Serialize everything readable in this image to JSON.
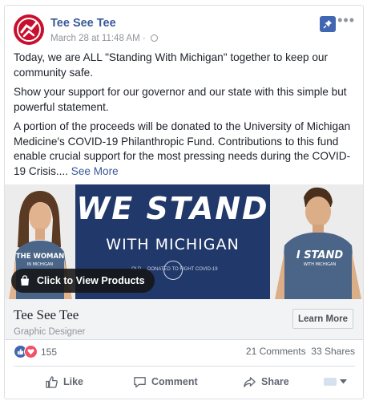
{
  "post": {
    "page_name": "Tee See Tee",
    "timestamp": "March 28 at 11:48 AM",
    "meta_separator": "·",
    "paragraphs": [
      "Today, we are ALL \"Standing With Michigan\" together to keep our community safe.",
      "Show your support for our governor and our state with this simple but powerful statement.",
      "A portion of the proceeds will be donated to the University of Michigan Medicine's COVID-19 Philanthropic Fund. Contributions to this fund enable crucial support for the most pressing needs during the COVID-19 Crisis...."
    ],
    "see_more": "See More"
  },
  "media": {
    "banner_line1": "WE STAND",
    "banner_line2": "WITH MICHIGAN",
    "banner_small_left": "OLD",
    "banner_small": "DONATED TO FIGHT COVID-19",
    "left_shirt_text_1": "THE WOMAN",
    "left_shirt_text_2": "IN MICHIGAN",
    "right_shirt_text_1": "I STAND",
    "right_shirt_text_2": "WITH MICHIGAN",
    "cta_label": "Click to View Products"
  },
  "link_footer": {
    "title": "Tee See Tee",
    "subtitle": "Graphic Designer",
    "button_label": "Learn More"
  },
  "stats": {
    "reactions_count": "155",
    "comments": "21 Comments",
    "shares": "33 Shares"
  },
  "actions": {
    "like": "Like",
    "comment": "Comment",
    "share": "Share"
  },
  "colors": {
    "brand_blue": "#4267b2",
    "link_blue": "#385898",
    "banner_navy": "#21386a",
    "love_red": "#f25268",
    "avatar_red": "#c8102e"
  }
}
